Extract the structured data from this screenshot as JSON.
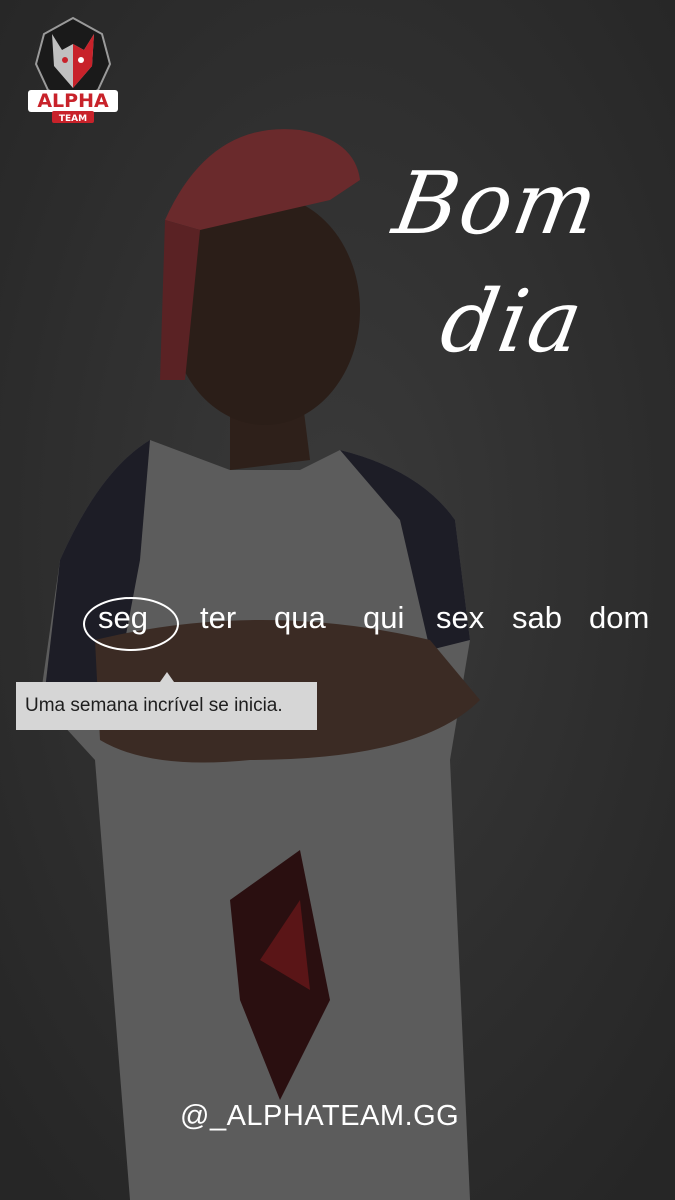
{
  "brand": {
    "logo_text_top": "ALPHA",
    "logo_text_bottom": "TEAM"
  },
  "greeting": {
    "line1": "Bom",
    "line2": "dia"
  },
  "weekdays": {
    "items": [
      "seg",
      "ter",
      "qua",
      "qui",
      "sex",
      "sab",
      "dom"
    ],
    "selected": "seg"
  },
  "tooltip": {
    "text": "Uma semana incrível se inicia."
  },
  "footer": {
    "handle": "@_ALPHATEAM.GG"
  },
  "colors": {
    "background": "#2f2f2f",
    "accent": "#c8222a",
    "tooltip_bg": "#d6d6d6"
  }
}
